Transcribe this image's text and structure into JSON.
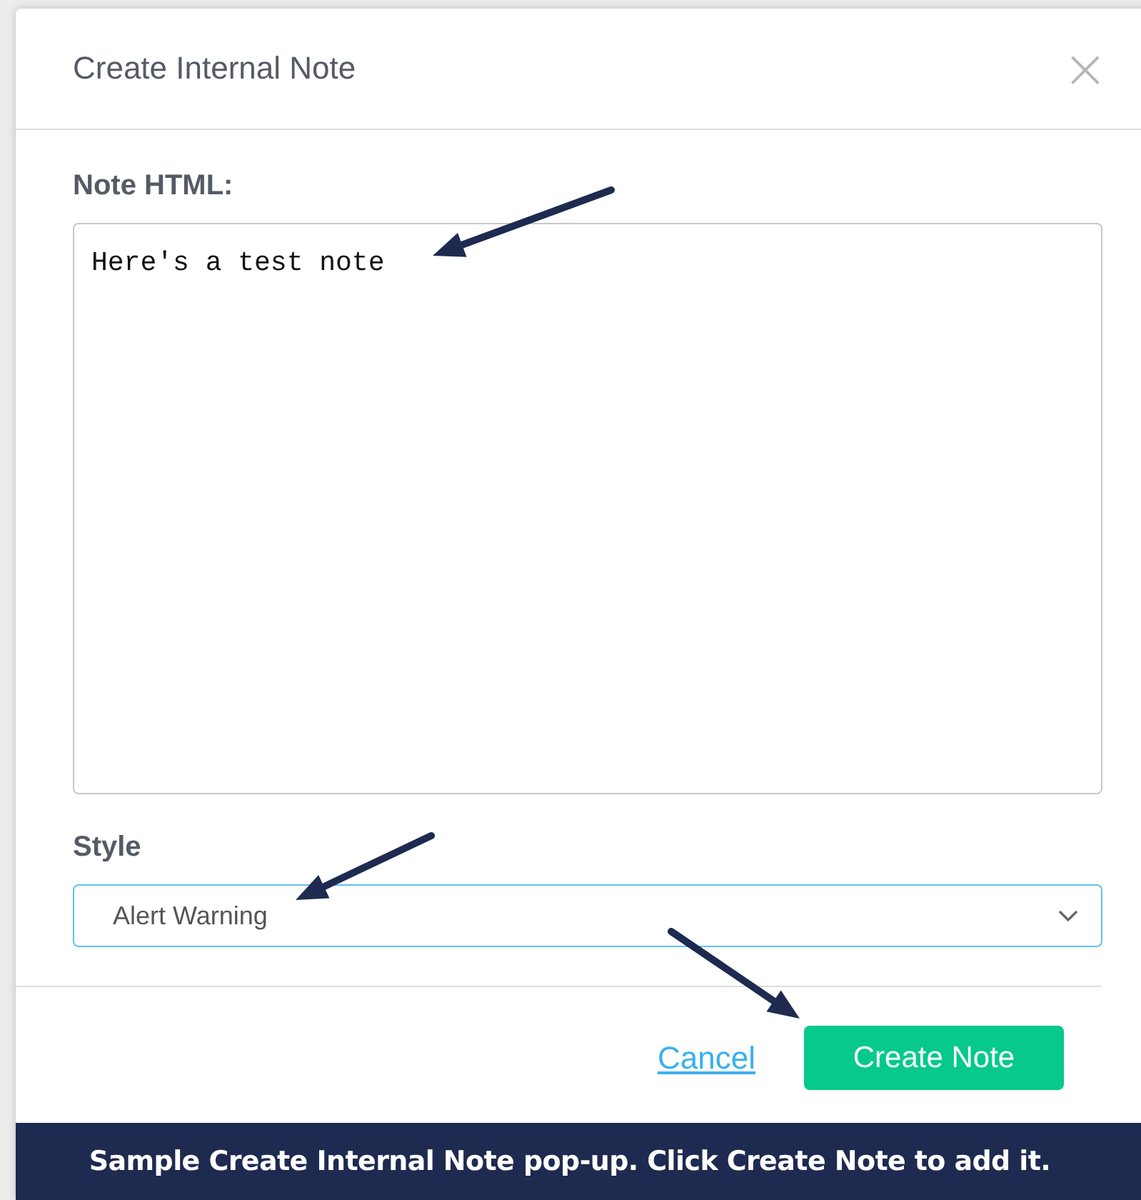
{
  "dialog": {
    "title": "Create Internal Note",
    "close": "×"
  },
  "note_field": {
    "label": "Note HTML:",
    "value": "Here's a test note"
  },
  "style_field": {
    "label": "Style",
    "value": "Alert Warning"
  },
  "actions": {
    "cancel": "Cancel",
    "submit": "Create Note"
  },
  "caption": "Sample Create Internal Note pop-up. Click Create Note to add it."
}
